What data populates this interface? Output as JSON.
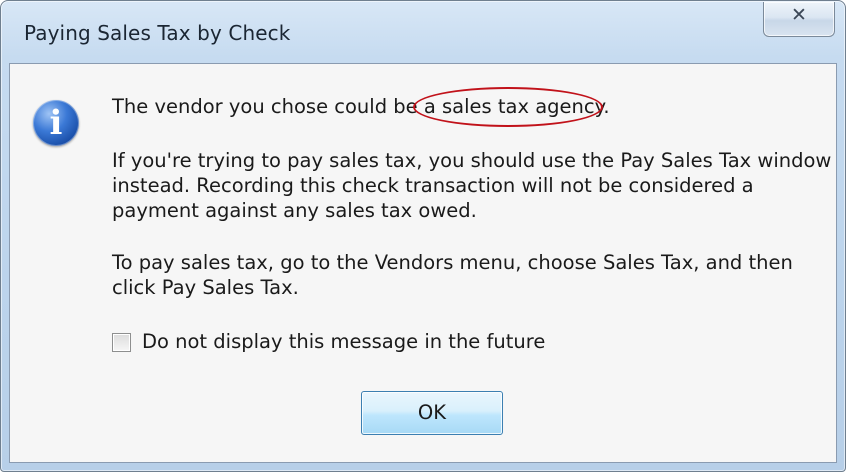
{
  "window": {
    "title": "Paying Sales Tax by Check",
    "close_glyph": "✕"
  },
  "icon": {
    "name": "info-icon",
    "glyph": "i"
  },
  "message": {
    "line1_prefix": "The vendor you chose could be ",
    "line1_highlight": "a sales tax agency.",
    "paragraph2": "If you're trying to pay sales tax, you should use the Pay Sales Tax window instead.  Recording this check transaction will not be considered a payment against any sales tax owed.",
    "paragraph3": "To pay sales tax, go to the Vendors menu, choose Sales Tax, and then click Pay Sales Tax."
  },
  "checkbox": {
    "label": "Do not display this message in the future",
    "checked": false
  },
  "buttons": {
    "ok_label": "OK"
  },
  "colors": {
    "highlight_circle": "#c1121a",
    "ok_button_border": "#3c7fb1"
  }
}
